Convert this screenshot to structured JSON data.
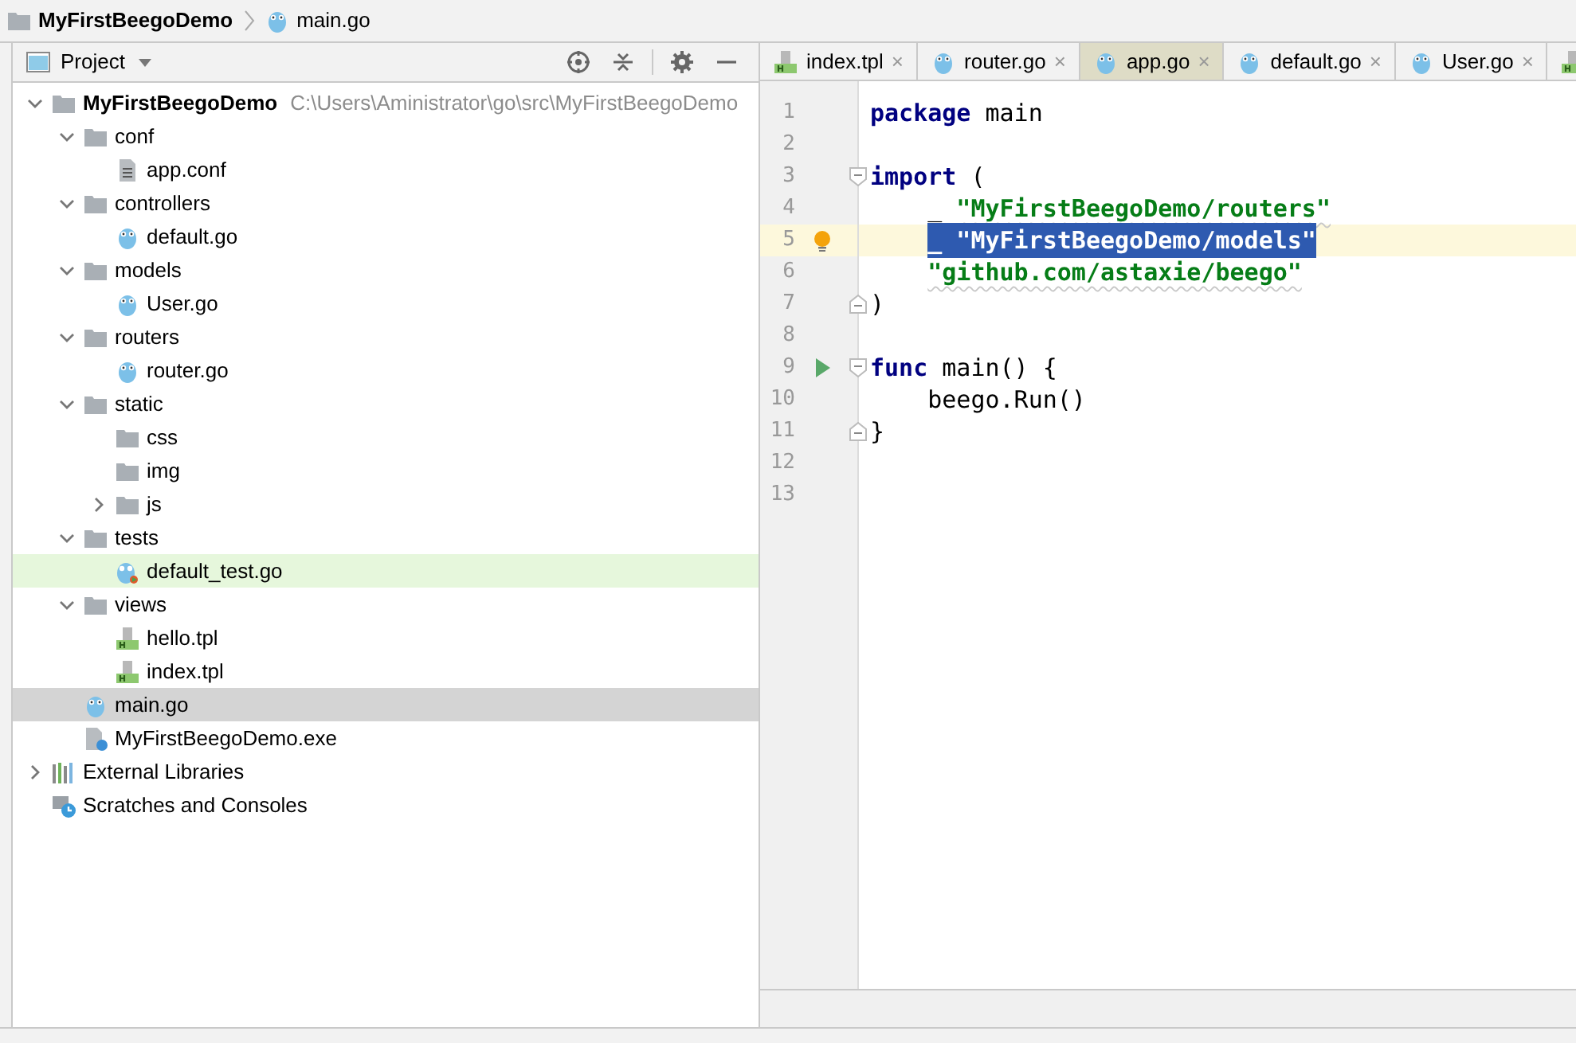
{
  "breadcrumb": [
    {
      "label": "MyFirstBeegoDemo",
      "kind": "folder"
    },
    {
      "label": "main.go",
      "kind": "go"
    }
  ],
  "project_panel": {
    "title": "Project",
    "tree": [
      {
        "label": "MyFirstBeegoDemo",
        "kind": "root",
        "path": "C:\\Users\\Aministrator\\go\\src\\MyFirstBeegoDemo",
        "expanded": true,
        "selected": false,
        "children": [
          {
            "label": "conf",
            "kind": "folder",
            "expanded": true,
            "selected": false,
            "children": [
              {
                "label": "app.conf",
                "kind": "text",
                "selected": false
              }
            ]
          },
          {
            "label": "controllers",
            "kind": "folder",
            "expanded": true,
            "selected": false,
            "children": [
              {
                "label": "default.go",
                "kind": "go",
                "selected": false
              }
            ]
          },
          {
            "label": "models",
            "kind": "folder",
            "expanded": true,
            "selected": false,
            "children": [
              {
                "label": "User.go",
                "kind": "go",
                "selected": false
              }
            ]
          },
          {
            "label": "routers",
            "kind": "folder",
            "expanded": true,
            "selected": false,
            "children": [
              {
                "label": "router.go",
                "kind": "go",
                "selected": false
              }
            ]
          },
          {
            "label": "static",
            "kind": "folder",
            "expanded": true,
            "selected": false,
            "children": [
              {
                "label": "css",
                "kind": "folder",
                "selected": false
              },
              {
                "label": "img",
                "kind": "folder",
                "selected": false
              },
              {
                "label": "js",
                "kind": "folder",
                "expanded": false,
                "selected": false
              }
            ]
          },
          {
            "label": "tests",
            "kind": "folder",
            "expanded": true,
            "selected": false,
            "children": [
              {
                "label": "default_test.go",
                "kind": "test",
                "selected": false
              }
            ]
          },
          {
            "label": "views",
            "kind": "folder",
            "expanded": true,
            "selected": false,
            "children": [
              {
                "label": "hello.tpl",
                "kind": "tpl",
                "selected": false
              },
              {
                "label": "index.tpl",
                "kind": "tpl",
                "selected": false
              }
            ]
          },
          {
            "label": "main.go",
            "kind": "go",
            "selected": true
          },
          {
            "label": "MyFirstBeegoDemo.exe",
            "kind": "unknown",
            "selected": false
          }
        ]
      },
      {
        "label": "External Libraries",
        "kind": "libraries",
        "expanded": false,
        "selected": false
      },
      {
        "label": "Scratches and Consoles",
        "kind": "scratches",
        "selected": false
      }
    ]
  },
  "tabs": [
    {
      "label": "index.tpl",
      "kind": "tpl",
      "selected": false
    },
    {
      "label": "router.go",
      "kind": "go",
      "selected": false
    },
    {
      "label": "app.go",
      "kind": "go",
      "selected": true
    },
    {
      "label": "default.go",
      "kind": "go",
      "selected": false
    },
    {
      "label": "User.go",
      "kind": "go",
      "selected": false
    },
    {
      "kind": "tpl",
      "selected": false
    }
  ],
  "close_glyph": "×",
  "code": [
    {
      "number": "1",
      "current": false,
      "segments": [
        {
          "text": "package",
          "kind": "keyword"
        },
        {
          "text": " main",
          "kind": "plain"
        }
      ]
    },
    {
      "number": "2"
    },
    {
      "number": "3",
      "current": false,
      "fold_start": true,
      "segments": [
        {
          "text": "import",
          "kind": "keyword"
        },
        {
          "text": " (",
          "kind": "plain"
        }
      ]
    },
    {
      "number": "4",
      "current": false,
      "indented": true,
      "segments": [
        {
          "text": "_ ",
          "kind": "plain"
        },
        {
          "text": "\"MyFirstBeegoDemo/routers\"",
          "kind": "string"
        }
      ]
    },
    {
      "number": "5",
      "current": true,
      "bulb": true,
      "indented": true,
      "segments": [
        {
          "text": "_ \"MyFirstBeegoDemo/models\"",
          "kind": "selected"
        }
      ]
    },
    {
      "number": "6",
      "current": false,
      "indented": true,
      "segments": [
        {
          "text": "\"github.com/astaxie/beego\"",
          "kind": "string"
        }
      ]
    },
    {
      "number": "7",
      "current": false,
      "fold_end": true,
      "segments": [
        {
          "text": ")",
          "kind": "plain"
        }
      ]
    },
    {
      "number": "8"
    },
    {
      "number": "9",
      "current": false,
      "fold_start": true,
      "run_marker": true,
      "segments": [
        {
          "text": "func",
          "kind": "keyword"
        },
        {
          "text": " main() {",
          "kind": "plain"
        }
      ]
    },
    {
      "number": "10",
      "current": false,
      "indented": true,
      "segments": [
        {
          "text": "beego.Run()",
          "kind": "plain"
        }
      ]
    },
    {
      "number": "11",
      "current": false,
      "fold_end": true,
      "segments": [
        {
          "text": "}",
          "kind": "plain"
        }
      ]
    },
    {
      "number": "12"
    },
    {
      "number": "13"
    }
  ]
}
